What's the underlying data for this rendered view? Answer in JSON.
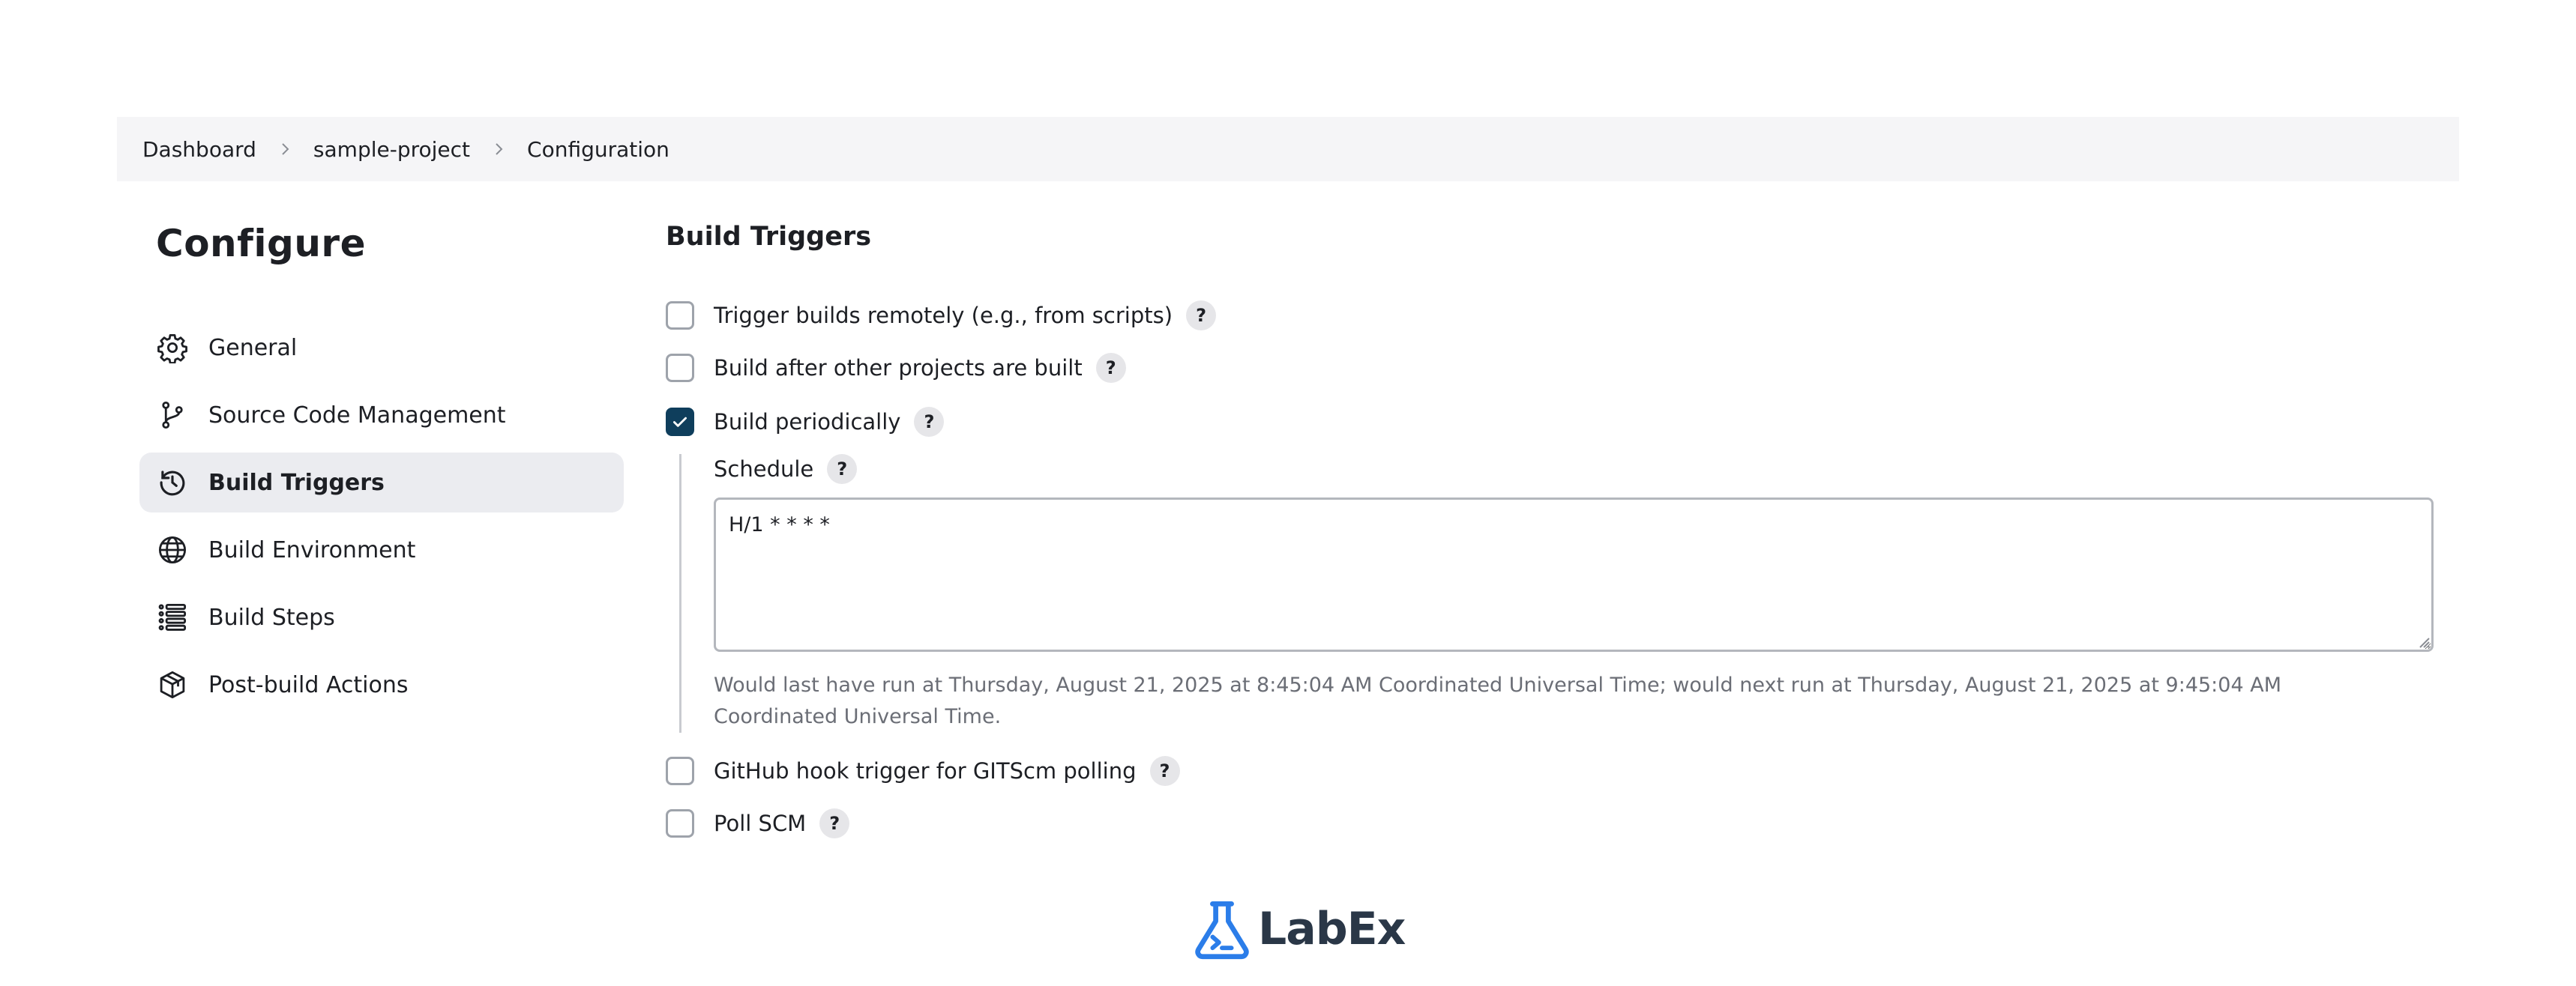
{
  "breadcrumb": {
    "items": [
      "Dashboard",
      "sample-project",
      "Configuration"
    ]
  },
  "page": {
    "title": "Configure"
  },
  "sidebar": {
    "items": [
      {
        "label": "General",
        "icon": "gear-icon"
      },
      {
        "label": "Source Code Management",
        "icon": "branch-icon"
      },
      {
        "label": "Build Triggers",
        "icon": "clock-history-icon",
        "active": true
      },
      {
        "label": "Build Environment",
        "icon": "globe-icon"
      },
      {
        "label": "Build Steps",
        "icon": "list-icon"
      },
      {
        "label": "Post-build Actions",
        "icon": "package-icon"
      }
    ]
  },
  "build_triggers": {
    "title": "Build Triggers",
    "options": [
      {
        "label": "Trigger builds remotely (e.g., from scripts)",
        "checked": false
      },
      {
        "label": "Build after other projects are built",
        "checked": false
      },
      {
        "label": "Build periodically",
        "checked": true
      },
      {
        "label": "GitHub hook trigger for GITScm polling",
        "checked": false
      },
      {
        "label": "Poll SCM",
        "checked": false
      }
    ],
    "help_label": "?",
    "schedule": {
      "label": "Schedule",
      "value": "H/1 * * * *",
      "info": "Would last have run at Thursday, August 21, 2025 at 8:45:04 AM Coordinated Universal Time; would next run at Thursday, August 21, 2025 at 9:45:04 AM Coordinated Universal Time."
    }
  },
  "footer": {
    "logo_text": "LabEx"
  },
  "colors": {
    "accent": "#0f3e5c",
    "breadcrumb_bg": "#f5f5f7",
    "active_nav_bg": "#ebecf0",
    "logo_blue": "#2b7de9"
  }
}
